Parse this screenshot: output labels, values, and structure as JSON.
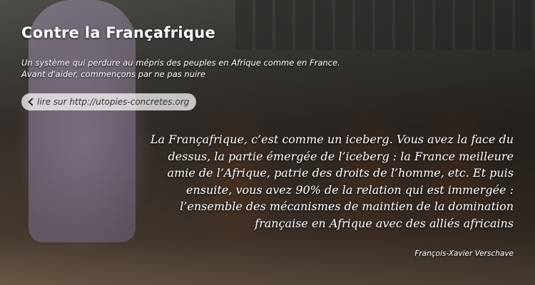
{
  "header": {
    "title": "Contre la Françafrique",
    "subtitle_lines": [
      "Un système qui perdure au mépris des peuples en Afrique comme en France.",
      "Avant d'aider, commençons par ne pas nuire"
    ]
  },
  "link": {
    "label": "lire sur http://utopies-concretes.org",
    "icon": "chevron-left-icon"
  },
  "quote": {
    "lines": [
      "La Françafrique, c’est comme un iceberg. Vous avez la face du",
      "dessus, la partie émergée de l’iceberg : la France meilleure",
      "amie de l’Afrique, patrie des droits de l’homme, etc. Et puis",
      "ensuite, vous avez 90% de la relation qui est immergée :",
      "l’ensemble des mécanismes de maintien de la domination",
      "française en Afrique avec des alliés africains"
    ],
    "author": "François-Xavier Verschave"
  }
}
